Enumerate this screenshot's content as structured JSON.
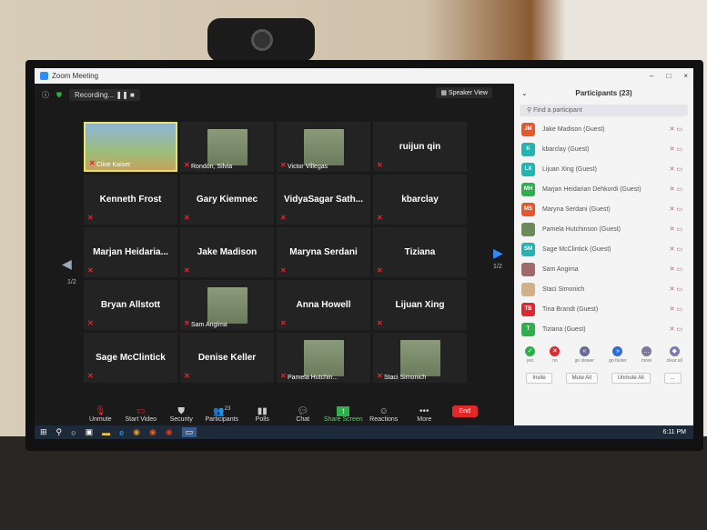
{
  "window": {
    "title": "Zoom Meeting",
    "controls": [
      "–",
      "□",
      "×"
    ]
  },
  "meeting": {
    "recording_label": "Recording...",
    "view_label": "Speaker View",
    "page": "1/2"
  },
  "tiles": [
    {
      "name": "Clive Kaiser",
      "type": "video"
    },
    {
      "name": "Rondon, Silvia",
      "type": "picture"
    },
    {
      "name": "Victor Villegas",
      "type": "picture"
    },
    {
      "name": "ruijun qin",
      "type": "name"
    },
    {
      "name": "Kenneth Frost",
      "type": "name"
    },
    {
      "name": "Gary Kiemnec",
      "type": "name"
    },
    {
      "name": "VidyaSagar  Sath...",
      "type": "name"
    },
    {
      "name": "kbarclay",
      "type": "name"
    },
    {
      "name": "Marjan  Heidaria...",
      "type": "name"
    },
    {
      "name": "Jake Madison",
      "type": "name"
    },
    {
      "name": "Maryna Serdani",
      "type": "name"
    },
    {
      "name": "Tiziana",
      "type": "name"
    },
    {
      "name": "Bryan Allstott",
      "type": "name"
    },
    {
      "name": "Sam Angima",
      "type": "picture"
    },
    {
      "name": "Anna Howell",
      "type": "name"
    },
    {
      "name": "Lijuan Xing",
      "type": "name"
    },
    {
      "name": "Sage McClintick",
      "type": "name"
    },
    {
      "name": "Denise Keller",
      "type": "name"
    },
    {
      "name": "Pamela Hutchin...",
      "type": "picture"
    },
    {
      "name": "Staci Simonich",
      "type": "picture"
    }
  ],
  "toolbar": {
    "unmute": "Unmute",
    "start_video": "Start Video",
    "security": "Security",
    "participants": "Participants",
    "participants_count": "23",
    "polls": "Polls",
    "chat": "Chat",
    "share_screen": "Share Screen",
    "reactions": "Reactions",
    "more": "More",
    "end": "End"
  },
  "panel": {
    "title": "Participants (23)",
    "search_placeholder": "Find a participant",
    "participants": [
      {
        "initials": "JM",
        "name": "Jake Madison (Guest)",
        "color": "#e8562a"
      },
      {
        "initials": "K",
        "name": "kbarclay (Guest)",
        "color": "#1fb5b0"
      },
      {
        "initials": "LX",
        "name": "Lijuan Xing (Guest)",
        "color": "#1fb5b0"
      },
      {
        "initials": "MH",
        "name": "Marjan Heidarian Dehkordi (Guest)",
        "color": "#2bb04a"
      },
      {
        "initials": "MS",
        "name": "Maryna Serdani (Guest)",
        "color": "#e8562a"
      },
      {
        "initials": "",
        "name": "Pamela Hutchinson (Guest)",
        "color": "#6a8a5a"
      },
      {
        "initials": "SM",
        "name": "Sage McClintick (Guest)",
        "color": "#1fb5b0"
      },
      {
        "initials": "",
        "name": "Sam Angima",
        "color": "#a06a6a"
      },
      {
        "initials": "",
        "name": "Staci Simonich",
        "color": "#d4b08a"
      },
      {
        "initials": "TB",
        "name": "Tina Brandt (Guest)",
        "color": "#e0262e"
      },
      {
        "initials": "T",
        "name": "Tiziana (Guest)",
        "color": "#2bb04a"
      }
    ],
    "reactions": [
      {
        "label": "yes",
        "color": "#2bb04a",
        "glyph": "✓"
      },
      {
        "label": "no",
        "color": "#e0262e",
        "glyph": "✕"
      },
      {
        "label": "go slower",
        "color": "#6a6a9a",
        "glyph": "«"
      },
      {
        "label": "go faster",
        "color": "#2d6cdf",
        "glyph": "»"
      },
      {
        "label": "more",
        "color": "#7a7a9a",
        "glyph": "…"
      },
      {
        "label": "clear all",
        "color": "#7a7aaa",
        "glyph": "◆"
      }
    ],
    "buttons": {
      "invite": "Invite",
      "mute_all": "Mute All",
      "unmute_all": "Unmute All",
      "more": "..."
    }
  },
  "taskbar": {
    "clock": "6:11 PM"
  }
}
